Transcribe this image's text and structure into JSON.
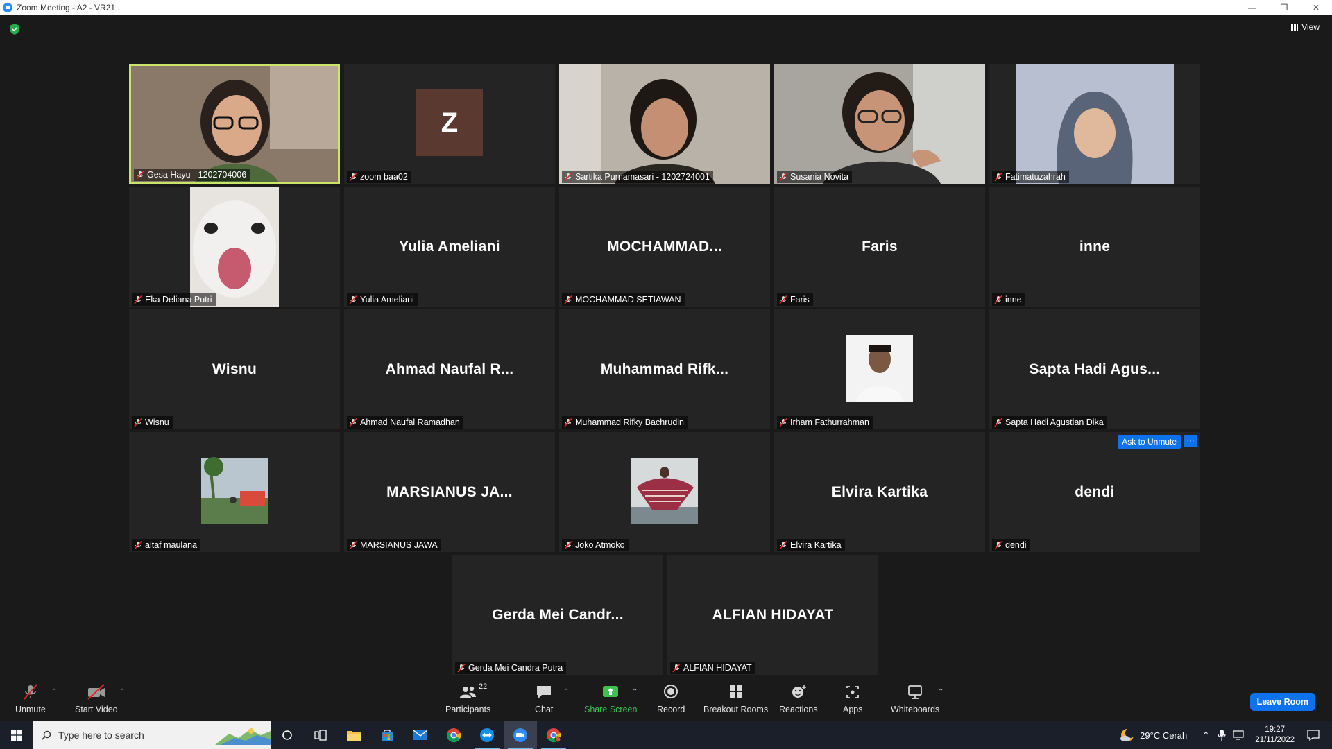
{
  "window": {
    "title": "Zoom Meeting - A2 - VR21"
  },
  "header": {
    "view_label": "View"
  },
  "participants": [
    {
      "label": "Gesa Hayu - 1202704006",
      "type": "video",
      "active": true
    },
    {
      "label": "zoom baa02",
      "type": "avatar",
      "initial": "Z"
    },
    {
      "label": "Sartika Purnamasari - 1202724001",
      "type": "video"
    },
    {
      "label": "Susania Novita",
      "type": "video"
    },
    {
      "label": "Fatimatuzahrah",
      "type": "video"
    },
    {
      "label": "Eka Deliana Putri",
      "type": "video"
    },
    {
      "label": "Yulia Ameliani",
      "type": "name",
      "display": "Yulia Ameliani"
    },
    {
      "label": "MOCHAMMAD SETIAWAN",
      "type": "name",
      "display": "MOCHAMMAD..."
    },
    {
      "label": "Faris",
      "type": "name",
      "display": "Faris"
    },
    {
      "label": "inne",
      "type": "name",
      "display": "inne"
    },
    {
      "label": "Wisnu",
      "type": "name",
      "display": "Wisnu"
    },
    {
      "label": "Ahmad Naufal Ramadhan",
      "type": "name",
      "display": "Ahmad  Naufal  R..."
    },
    {
      "label": "Muhammad Rifky Bachrudin",
      "type": "name",
      "display": "Muhammad  Rifk..."
    },
    {
      "label": "Irham Fathurrahman",
      "type": "photo"
    },
    {
      "label": "Sapta Hadi Agustian Dika",
      "type": "name",
      "display": "Sapta Hadi Agus..."
    },
    {
      "label": "altaf maulana",
      "type": "photo"
    },
    {
      "label": "MARSIANUS JAWA",
      "type": "name",
      "display": "MARSIANUS  JA..."
    },
    {
      "label": "Joko Atmoko",
      "type": "photo"
    },
    {
      "label": "Elvira Kartika",
      "type": "name",
      "display": "Elvira Kartika"
    },
    {
      "label": "dendi",
      "type": "name",
      "display": "dendi",
      "ask_unmute": "Ask to Unmute",
      "more": "···"
    },
    {
      "label": "Gerda Mei Candra Putra",
      "type": "name",
      "display": "Gerda Mei Candr..."
    },
    {
      "label": "ALFIAN HIDAYAT",
      "type": "name",
      "display": "ALFIAN HIDAYAT"
    }
  ],
  "toolbar": {
    "unmute": "Unmute",
    "start_video": "Start Video",
    "participants": "Participants",
    "participants_count": "22",
    "chat": "Chat",
    "share_screen": "Share Screen",
    "record": "Record",
    "breakout_rooms": "Breakout Rooms",
    "reactions": "Reactions",
    "apps": "Apps",
    "whiteboards": "Whiteboards",
    "leave": "Leave Room"
  },
  "taskbar": {
    "search_placeholder": "Type here to search",
    "weather": "29°C  Cerah",
    "time": "19:27",
    "date": "21/11/2022"
  },
  "colors": {
    "accent_blue": "#0e72ed",
    "active_speaker": "#c9e66b",
    "share_green": "#3ec24f",
    "mute_red": "#e02828"
  }
}
